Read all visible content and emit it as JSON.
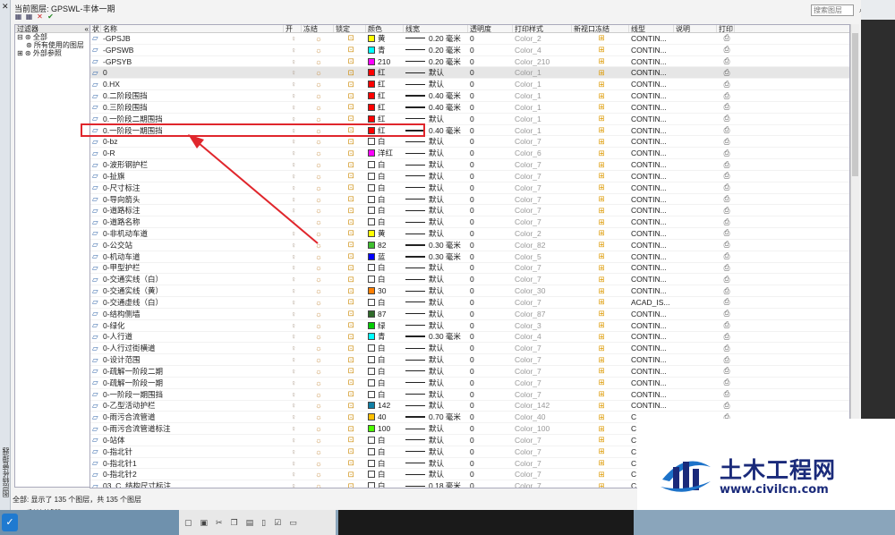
{
  "window": {
    "current_layer_label": "当前图层: GPSWL-丰体一期",
    "search_placeholder": "搜索图层",
    "side_tab": "图层特性管理器",
    "close_x": "✕"
  },
  "toolbar": {
    "icons": [
      "new-layer-icon",
      "new-layer-vp-icon",
      "delete-layer-icon",
      "set-current-icon"
    ],
    "glyphs": [
      "▦",
      "▦",
      "✕",
      "✔"
    ]
  },
  "tree": {
    "header": "过滤器",
    "items": [
      {
        "label": "⊟ ⊛ 全部"
      },
      {
        "label": "   ⊛ 所有使用的图层"
      },
      {
        "label": "⊞ ⊛ 外部参照"
      }
    ],
    "invert_label": "反转过滤器(I)"
  },
  "columns": [
    "状",
    "名称",
    "开",
    "冻结",
    "锁定",
    "颜色",
    "线宽",
    "透明度",
    "打印样式",
    "新视口冻结",
    "线型",
    "说明",
    "打印"
  ],
  "rows": [
    {
      "name": "-GPSJB",
      "color": "黄",
      "hex": "#ffff00",
      "lw": "0.20 毫米",
      "bold": false,
      "ps": "Color_2",
      "lt": "CONTIN..."
    },
    {
      "name": "-GPSWB",
      "color": "青",
      "hex": "#00ffff",
      "lw": "0.20 毫米",
      "bold": false,
      "ps": "Color_4",
      "lt": "CONTIN..."
    },
    {
      "name": "-GPSYB",
      "color": "210",
      "hex": "#ff00ff",
      "lw": "0.20 毫米",
      "bold": false,
      "ps": "Color_210",
      "lt": "CONTIN..."
    },
    {
      "name": "0",
      "color": "红",
      "hex": "#ff0000",
      "lw": "默认",
      "bold": false,
      "ps": "Color_1",
      "lt": "CONTIN...",
      "sel": true
    },
    {
      "name": "0.HX",
      "color": "红",
      "hex": "#ff0000",
      "lw": "默认",
      "bold": false,
      "ps": "Color_1",
      "lt": "CONTIN..."
    },
    {
      "name": "0.二阶段围挡",
      "color": "红",
      "hex": "#ff0000",
      "lw": "0.40 毫米",
      "bold": true,
      "ps": "Color_1",
      "lt": "CONTIN..."
    },
    {
      "name": "0.三阶段围挡",
      "color": "红",
      "hex": "#ff0000",
      "lw": "0.40 毫米",
      "bold": true,
      "ps": "Color_1",
      "lt": "CONTIN..."
    },
    {
      "name": "0.一阶段二期围挡",
      "color": "红",
      "hex": "#ff0000",
      "lw": "默认",
      "bold": false,
      "ps": "Color_1",
      "lt": "CONTIN..."
    },
    {
      "name": "0.一阶段一期围挡",
      "color": "红",
      "hex": "#ff0000",
      "lw": "0.40 毫米",
      "bold": true,
      "ps": "Color_1",
      "lt": "CONTIN..."
    },
    {
      "name": "0-bz",
      "color": "白",
      "hex": "#ffffff",
      "lw": "默认",
      "bold": false,
      "ps": "Color_7",
      "lt": "CONTIN..."
    },
    {
      "name": "0-R",
      "color": "洋红",
      "hex": "#ff00ff",
      "lw": "默认",
      "bold": false,
      "ps": "Color_6",
      "lt": "CONTIN..."
    },
    {
      "name": "0-波形钢护栏",
      "color": "白",
      "hex": "#ffffff",
      "lw": "默认",
      "bold": false,
      "ps": "Color_7",
      "lt": "CONTIN..."
    },
    {
      "name": "0-扯旗",
      "color": "白",
      "hex": "#ffffff",
      "lw": "默认",
      "bold": false,
      "ps": "Color_7",
      "lt": "CONTIN..."
    },
    {
      "name": "0-尺寸标注",
      "color": "白",
      "hex": "#ffffff",
      "lw": "默认",
      "bold": false,
      "ps": "Color_7",
      "lt": "CONTIN..."
    },
    {
      "name": "0-导向箭头",
      "color": "白",
      "hex": "#ffffff",
      "lw": "默认",
      "bold": false,
      "ps": "Color_7",
      "lt": "CONTIN..."
    },
    {
      "name": "0-道路标注",
      "color": "白",
      "hex": "#ffffff",
      "lw": "默认",
      "bold": false,
      "ps": "Color_7",
      "lt": "CONTIN..."
    },
    {
      "name": "0-道路名称",
      "color": "白",
      "hex": "#ffffff",
      "lw": "默认",
      "bold": false,
      "ps": "Color_7",
      "lt": "CONTIN..."
    },
    {
      "name": "0-非机动车道",
      "color": "黄",
      "hex": "#ffff00",
      "lw": "默认",
      "bold": false,
      "ps": "Color_2",
      "lt": "CONTIN..."
    },
    {
      "name": "0-公交站",
      "color": "82",
      "hex": "#3fbf2f",
      "lw": "0.30 毫米",
      "bold": true,
      "ps": "Color_82",
      "lt": "CONTIN..."
    },
    {
      "name": "0-机动车道",
      "color": "蓝",
      "hex": "#0000ff",
      "lw": "0.30 毫米",
      "bold": true,
      "ps": "Color_5",
      "lt": "CONTIN..."
    },
    {
      "name": "0-甲型护栏",
      "color": "白",
      "hex": "#ffffff",
      "lw": "默认",
      "bold": false,
      "ps": "Color_7",
      "lt": "CONTIN..."
    },
    {
      "name": "0-交通实线（白）",
      "color": "白",
      "hex": "#ffffff",
      "lw": "默认",
      "bold": false,
      "ps": "Color_7",
      "lt": "CONTIN..."
    },
    {
      "name": "0-交通实线（黄）",
      "color": "30",
      "hex": "#ff7f00",
      "lw": "默认",
      "bold": false,
      "ps": "Color_30",
      "lt": "CONTIN..."
    },
    {
      "name": "0-交通虚线（白）",
      "color": "白",
      "hex": "#ffffff",
      "lw": "默认",
      "bold": false,
      "ps": "Color_7",
      "lt": "ACAD_IS..."
    },
    {
      "name": "0-结构侧墙",
      "color": "87",
      "hex": "#2f6a2a",
      "lw": "默认",
      "bold": false,
      "ps": "Color_87",
      "lt": "CONTIN..."
    },
    {
      "name": "0-绿化",
      "color": "绿",
      "hex": "#00cc00",
      "lw": "默认",
      "bold": false,
      "ps": "Color_3",
      "lt": "CONTIN..."
    },
    {
      "name": "0-人行道",
      "color": "青",
      "hex": "#00ffff",
      "lw": "0.30 毫米",
      "bold": true,
      "ps": "Color_4",
      "lt": "CONTIN..."
    },
    {
      "name": "0-人行过街横道",
      "color": "白",
      "hex": "#ffffff",
      "lw": "默认",
      "bold": false,
      "ps": "Color_7",
      "lt": "CONTIN..."
    },
    {
      "name": "0-设计范围",
      "color": "白",
      "hex": "#ffffff",
      "lw": "默认",
      "bold": false,
      "ps": "Color_7",
      "lt": "CONTIN..."
    },
    {
      "name": "0-疏解一阶段二期",
      "color": "白",
      "hex": "#ffffff",
      "lw": "默认",
      "bold": false,
      "ps": "Color_7",
      "lt": "CONTIN..."
    },
    {
      "name": "0-疏解一阶段一期",
      "color": "白",
      "hex": "#ffffff",
      "lw": "默认",
      "bold": false,
      "ps": "Color_7",
      "lt": "CONTIN..."
    },
    {
      "name": "0-一阶段一期围挡",
      "color": "白",
      "hex": "#ffffff",
      "lw": "默认",
      "bold": false,
      "ps": "Color_7",
      "lt": "CONTIN..."
    },
    {
      "name": "0-乙型活动护栏",
      "color": "142",
      "hex": "#0f7fa5",
      "lw": "默认",
      "bold": false,
      "ps": "Color_142",
      "lt": "CONTIN..."
    },
    {
      "name": "0-雨污合流管道",
      "color": "40",
      "hex": "#ffbf00",
      "lw": "0.70 毫米",
      "bold": true,
      "ps": "Color_40",
      "lt": "C"
    },
    {
      "name": "0-雨污合流管道标注",
      "color": "100",
      "hex": "#4cff00",
      "lw": "默认",
      "bold": false,
      "ps": "Color_100",
      "lt": "C"
    },
    {
      "name": "0-站体",
      "color": "白",
      "hex": "#ffffff",
      "lw": "默认",
      "bold": false,
      "ps": "Color_7",
      "lt": "C"
    },
    {
      "name": "0-指北针",
      "color": "白",
      "hex": "#ffffff",
      "lw": "默认",
      "bold": false,
      "ps": "Color_7",
      "lt": "C"
    },
    {
      "name": "0-指北针1",
      "color": "白",
      "hex": "#ffffff",
      "lw": "默认",
      "bold": false,
      "ps": "Color_7",
      "lt": "C"
    },
    {
      "name": "0-指北针2",
      "color": "白",
      "hex": "#ffffff",
      "lw": "默认",
      "bold": false,
      "ps": "Color_7",
      "lt": "C"
    },
    {
      "name": "03_C_结构尺寸标注",
      "color": "白",
      "hex": "#ffffff",
      "lw": "0.18 毫米",
      "bold": false,
      "ps": "Color_7",
      "lt": "C"
    }
  ],
  "transparency": "0",
  "status": "全部: 显示了 135 个图层，共 135 个图层",
  "watermark": {
    "title": "土木工程网",
    "url": "www.civilcn.com"
  },
  "accent": "#e0262c"
}
